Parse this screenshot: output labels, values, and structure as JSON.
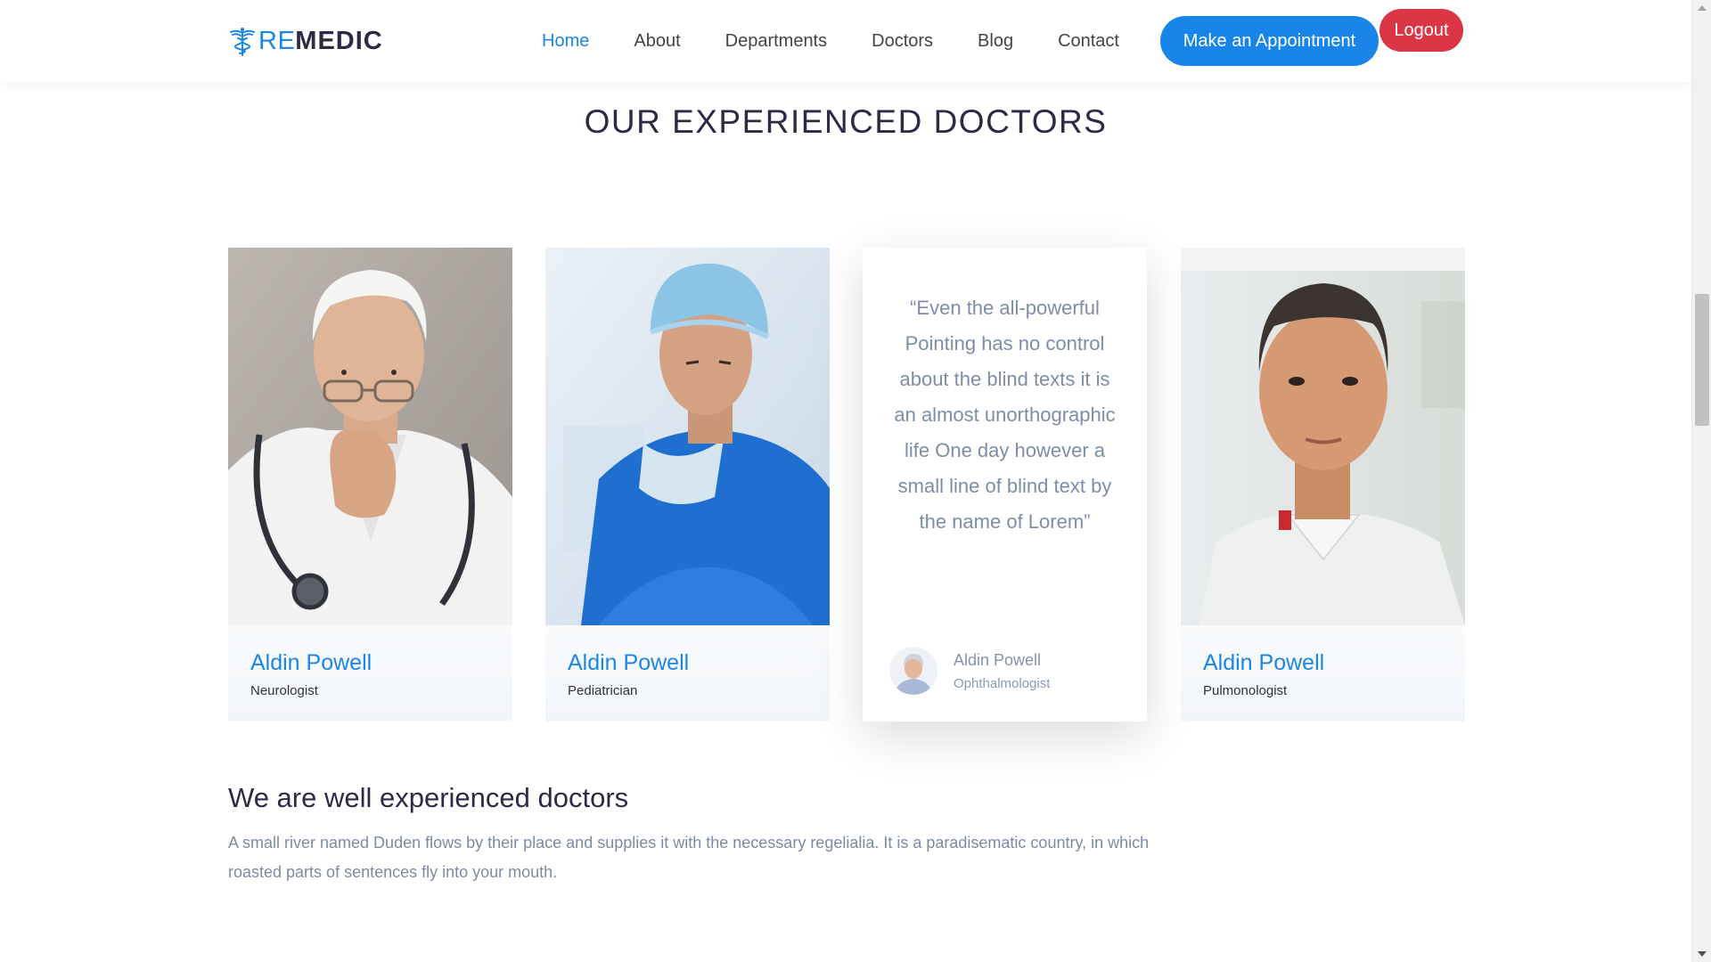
{
  "brand": {
    "part1": "RE",
    "part2": "MEDIC",
    "icon": "caduceus-icon"
  },
  "nav": {
    "items": [
      {
        "label": "Home",
        "active": true
      },
      {
        "label": "About",
        "active": false
      },
      {
        "label": "Departments",
        "active": false
      },
      {
        "label": "Doctors",
        "active": false
      },
      {
        "label": "Blog",
        "active": false
      },
      {
        "label": "Contact",
        "active": false
      }
    ],
    "appointment_label": "Make an Appointment",
    "logout_label": "Logout"
  },
  "section": {
    "title": "OUR EXPERIENCED DOCTORS"
  },
  "doctors": [
    {
      "name": "Aldin Powell",
      "specialty": "Neurologist"
    },
    {
      "name": "Aldin Powell",
      "specialty": "Pediatrician"
    },
    {
      "name": "Aldin Powell",
      "specialty": "Pulmonologist"
    }
  ],
  "testimonial": {
    "quote": "“Even the all-powerful Pointing has no control about the blind texts it is an almost unorthographic life One day however a small line of blind text by the name of Lorem”",
    "name": "Aldin Powell",
    "specialty": "Ophthalmologist"
  },
  "about": {
    "title": "We are well experienced doctors",
    "text": "A small river named Duden flows by their place and supplies it with the necessary regelialia. It is a paradisematic country, in which roasted parts of sentences fly into your mouth."
  },
  "colors": {
    "accent": "#1c86e6",
    "logout": "#dc3545",
    "heading": "#2b2b45",
    "muted": "#7d8aa4"
  }
}
